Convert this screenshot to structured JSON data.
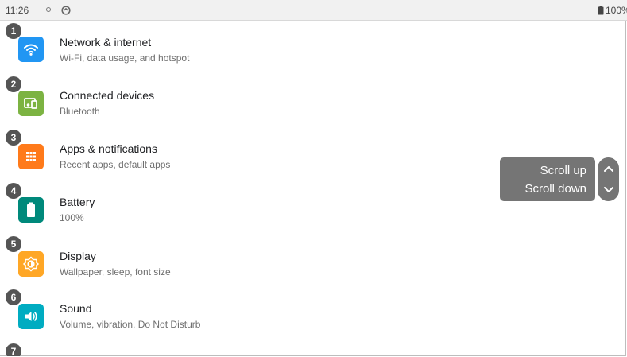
{
  "status_bar": {
    "time": "11:26",
    "battery": "100%",
    "icons": [
      "notification-dot-icon",
      "sync-icon",
      "battery-icon"
    ]
  },
  "settings": [
    {
      "number": "1",
      "title": "Network & internet",
      "subtitle": "Wi-Fi, data usage, and hotspot",
      "icon": "wifi-icon",
      "color": "#2196F3"
    },
    {
      "number": "2",
      "title": "Connected devices",
      "subtitle": "Bluetooth",
      "icon": "connected-devices-icon",
      "color": "#7CB342"
    },
    {
      "number": "3",
      "title": "Apps & notifications",
      "subtitle": "Recent apps, default apps",
      "icon": "apps-grid-icon",
      "color": "#FF7A1A"
    },
    {
      "number": "4",
      "title": "Battery",
      "subtitle": "100%",
      "icon": "battery-icon",
      "color": "#00897B"
    },
    {
      "number": "5",
      "title": "Display",
      "subtitle": "Wallpaper, sleep, font size",
      "icon": "brightness-icon",
      "color": "#FFA726"
    },
    {
      "number": "6",
      "title": "Sound",
      "subtitle": "Volume, vibration, Do Not Disturb",
      "icon": "volume-icon",
      "color": "#00ACC1"
    },
    {
      "number": "7"
    }
  ],
  "scroll_controls": {
    "up_label": "Scroll up",
    "down_label": "Scroll down",
    "icons": [
      "chevron-up-icon",
      "chevron-down-icon"
    ],
    "color": "#757575"
  }
}
